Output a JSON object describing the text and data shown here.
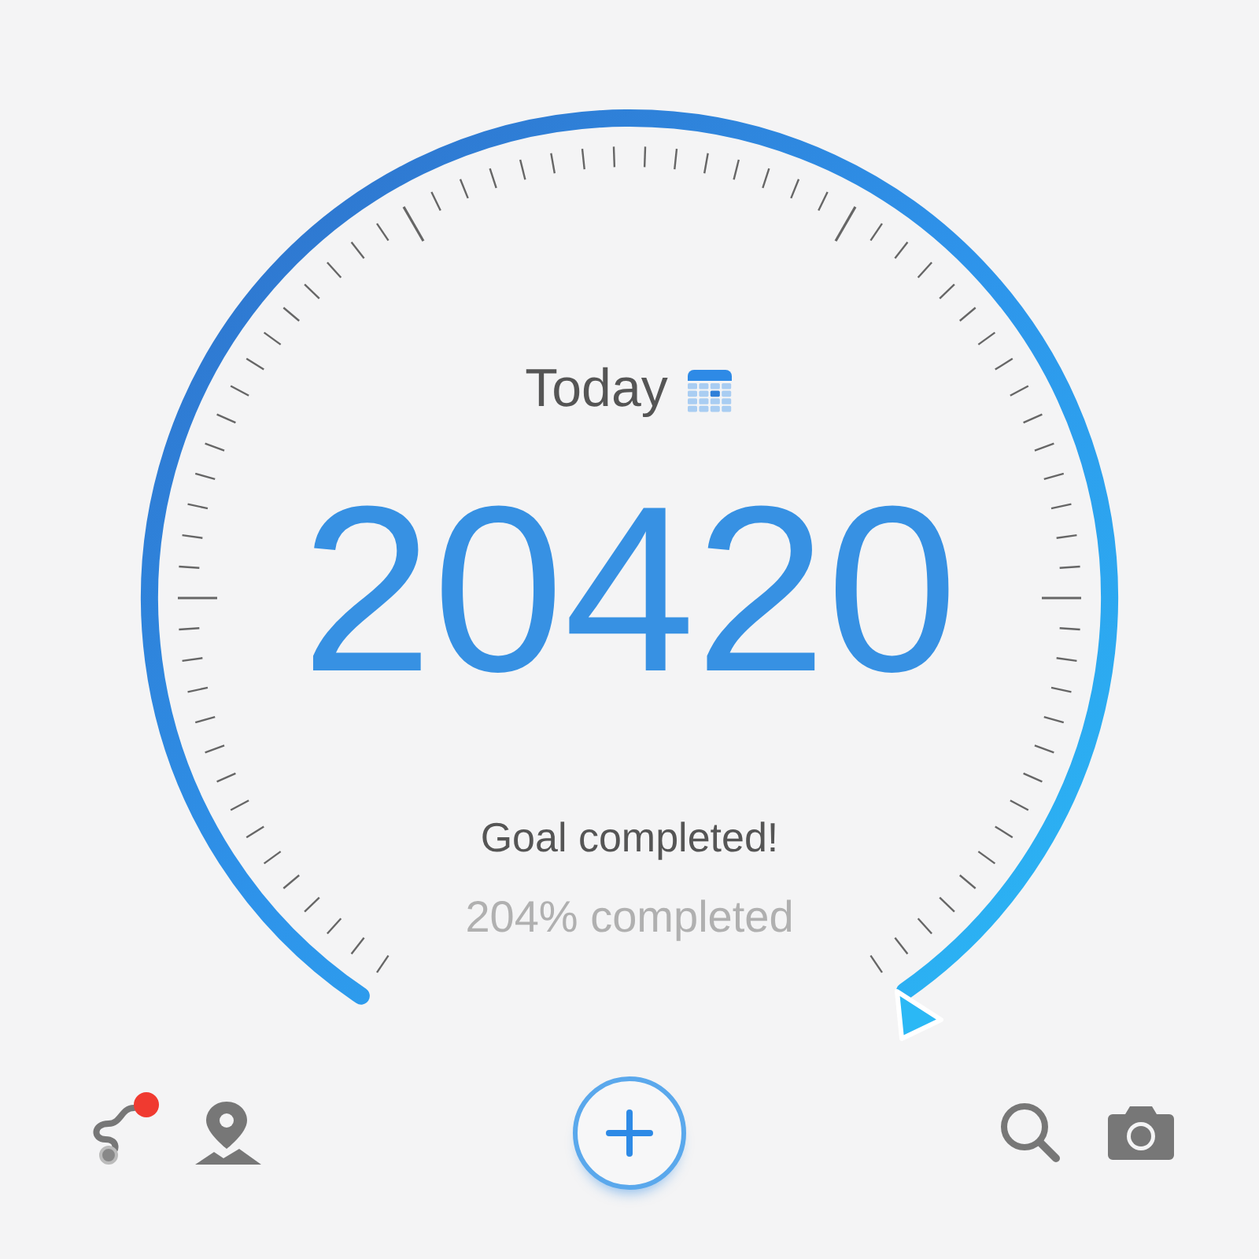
{
  "header": {
    "title": "Today"
  },
  "steps": "20420",
  "goal_message": "Goal completed!",
  "percent": "204% completed",
  "toolbar": [
    {
      "kind": "route",
      "badge": true
    },
    {
      "kind": "map"
    },
    {
      "kind": "add"
    },
    {
      "kind": "search"
    },
    {
      "kind": "camera"
    }
  ]
}
